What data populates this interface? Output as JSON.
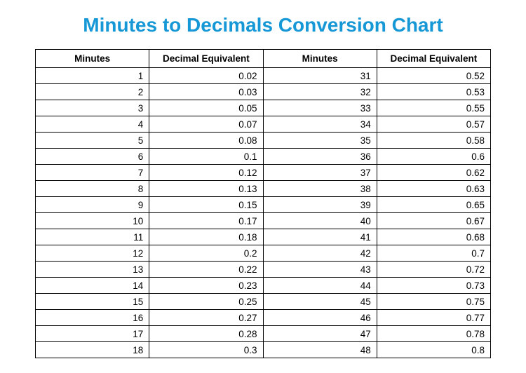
{
  "title": "Minutes to Decimals Conversion Chart",
  "headers": {
    "minutes": "Minutes",
    "decimal": "Decimal Equivalent"
  },
  "rows": [
    {
      "m1": "1",
      "d1": "0.02",
      "m2": "31",
      "d2": "0.52"
    },
    {
      "m1": "2",
      "d1": "0.03",
      "m2": "32",
      "d2": "0.53"
    },
    {
      "m1": "3",
      "d1": "0.05",
      "m2": "33",
      "d2": "0.55"
    },
    {
      "m1": "4",
      "d1": "0.07",
      "m2": "34",
      "d2": "0.57"
    },
    {
      "m1": "5",
      "d1": "0.08",
      "m2": "35",
      "d2": "0.58"
    },
    {
      "m1": "6",
      "d1": "0.1",
      "m2": "36",
      "d2": "0.6"
    },
    {
      "m1": "7",
      "d1": "0.12",
      "m2": "37",
      "d2": "0.62"
    },
    {
      "m1": "8",
      "d1": "0.13",
      "m2": "38",
      "d2": "0.63"
    },
    {
      "m1": "9",
      "d1": "0.15",
      "m2": "39",
      "d2": "0.65"
    },
    {
      "m1": "10",
      "d1": "0.17",
      "m2": "40",
      "d2": "0.67"
    },
    {
      "m1": "11",
      "d1": "0.18",
      "m2": "41",
      "d2": "0.68"
    },
    {
      "m1": "12",
      "d1": "0.2",
      "m2": "42",
      "d2": "0.7"
    },
    {
      "m1": "13",
      "d1": "0.22",
      "m2": "43",
      "d2": "0.72"
    },
    {
      "m1": "14",
      "d1": "0.23",
      "m2": "44",
      "d2": "0.73"
    },
    {
      "m1": "15",
      "d1": "0.25",
      "m2": "45",
      "d2": "0.75"
    },
    {
      "m1": "16",
      "d1": "0.27",
      "m2": "46",
      "d2": "0.77"
    },
    {
      "m1": "17",
      "d1": "0.28",
      "m2": "47",
      "d2": "0.78"
    },
    {
      "m1": "18",
      "d1": "0.3",
      "m2": "48",
      "d2": "0.8"
    }
  ]
}
